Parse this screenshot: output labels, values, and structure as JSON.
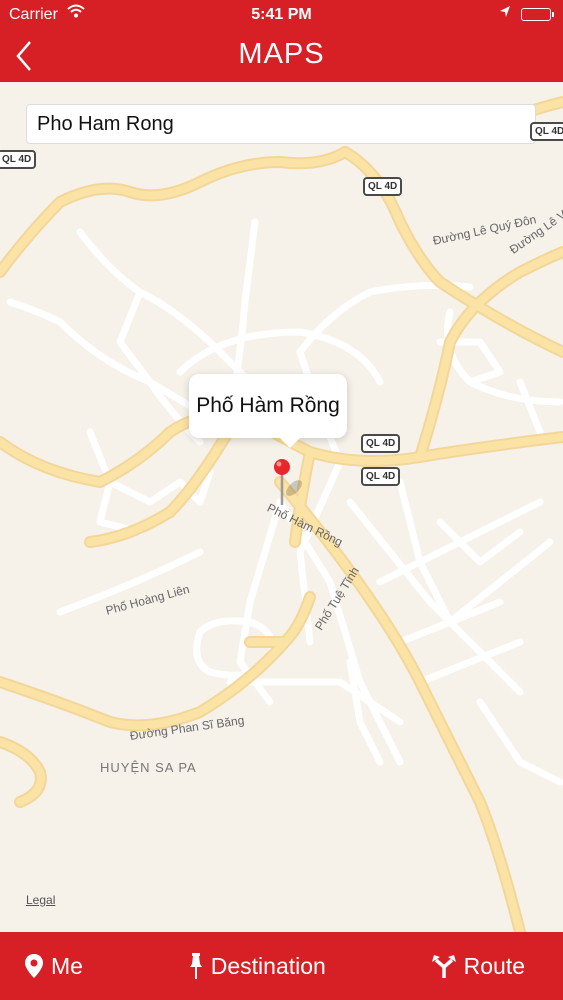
{
  "status_bar": {
    "carrier": "Carrier",
    "time": "5:41 PM"
  },
  "nav": {
    "title": "MAPS"
  },
  "search": {
    "value": "Pho Ham Rong"
  },
  "map": {
    "shields": [
      "QL 4D",
      "QL 4D",
      "QL 4D",
      "QL 4D",
      "QL 4D"
    ],
    "roads": [
      "Đường Lê Quý Đôn",
      "Đường Lê V",
      "Phố Hàm Rồng",
      "Phố Hoàng Liên",
      "Phố Tuệ Tĩnh",
      "Đường Phan Sĩ Băng"
    ],
    "district": "HUYỆN SA PA",
    "callout": "Phố Hàm Rồng",
    "legal": "Legal"
  },
  "tabs": {
    "me": "Me",
    "destination": "Destination",
    "route": "Route"
  },
  "colors": {
    "accent": "#d71f26",
    "major_road": "#fbe2a5",
    "map_bg": "#f6f1e9"
  }
}
